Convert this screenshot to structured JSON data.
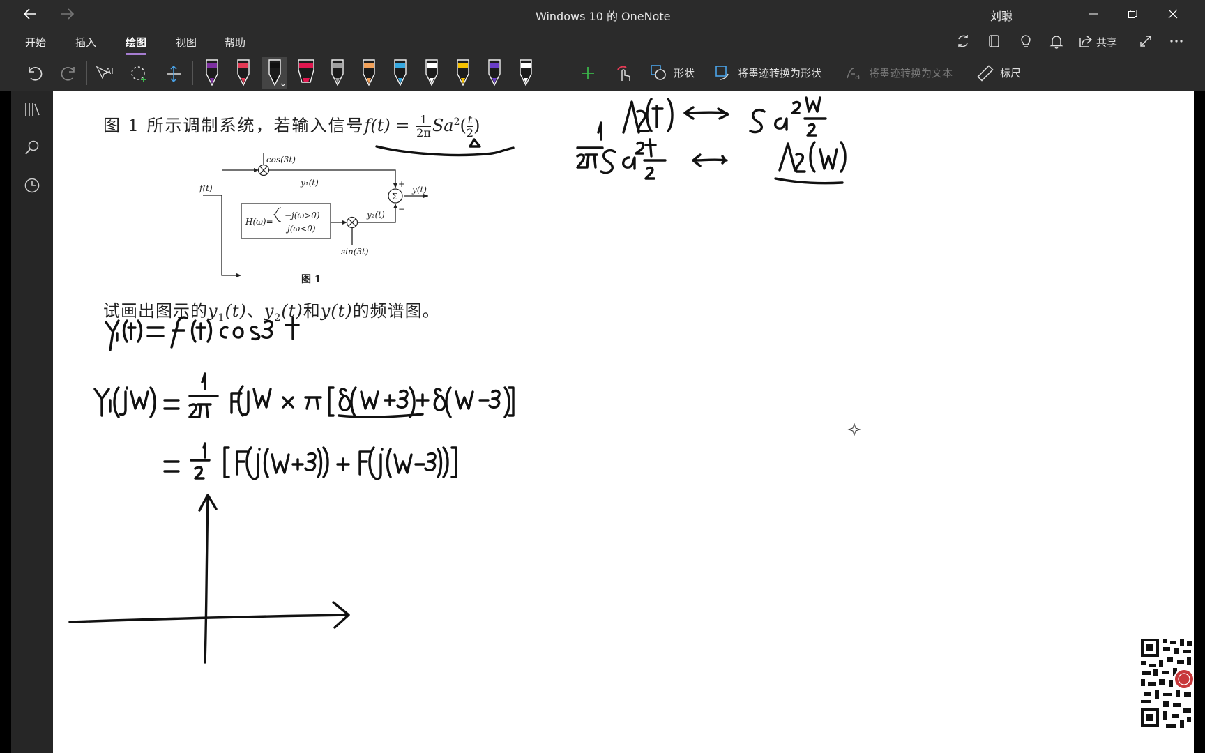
{
  "window": {
    "title": "Windows 10 的 OneNote",
    "user": "刘聪"
  },
  "tabs": [
    {
      "label": "开始"
    },
    {
      "label": "插入"
    },
    {
      "label": "绘图",
      "active": true
    },
    {
      "label": "视图"
    },
    {
      "label": "帮助"
    }
  ],
  "header_actions": {
    "share_label": "共享"
  },
  "toolbar": {
    "shapes_label": "形状",
    "ink_to_shape_label": "将墨迹转换为形状",
    "ink_to_text_label": "将墨迹转换为文本",
    "ruler_label": "标尺"
  },
  "pens": [
    {
      "color": "#7d2fa0"
    },
    {
      "color": "#e33a54"
    },
    {
      "color": "#111111",
      "selected": true
    },
    {
      "color": "#e0174f",
      "kind": "highlighter"
    },
    {
      "color": "#9e9e9e"
    },
    {
      "color": "#f2a15a"
    },
    {
      "color": "#36a8e0"
    },
    {
      "color": "#ffffff"
    },
    {
      "color": "#f5c000"
    },
    {
      "color": "#6a3ec7"
    },
    {
      "color": "#ffffff"
    }
  ],
  "note": {
    "problem_intro": "图 1 所示调制系统，若输入信号",
    "problem_formula": "f(t) = ",
    "formula_frac_num": "1",
    "formula_frac_den": "2π",
    "formula_sa": "Sa",
    "formula_exp": "2",
    "formula_arg_num": "t",
    "formula_arg_den": "2",
    "question_prefix": "试画出图示的",
    "question_y1": "y",
    "question_y1_sub": "1",
    "question_t": "(t)",
    "question_sep": "、",
    "question_y2": "y",
    "question_y2_sub": "2",
    "question_and": "和",
    "question_y": "y(t)",
    "question_suffix": "的频谱图。",
    "figure": {
      "caption": "图 1",
      "cos_label": "cos(3t)",
      "sin_label": "sin(3t)",
      "f_label": "f(t)",
      "y1_label": "y₁(t)",
      "y2_label": "y₂(t)",
      "y_label": "y(t)",
      "sigma": "Σ",
      "plus": "+",
      "minus": "−",
      "h_label": "H(ω)=",
      "h_case1": "−j(ω>0)",
      "h_case2": "j(ω<0)"
    }
  }
}
